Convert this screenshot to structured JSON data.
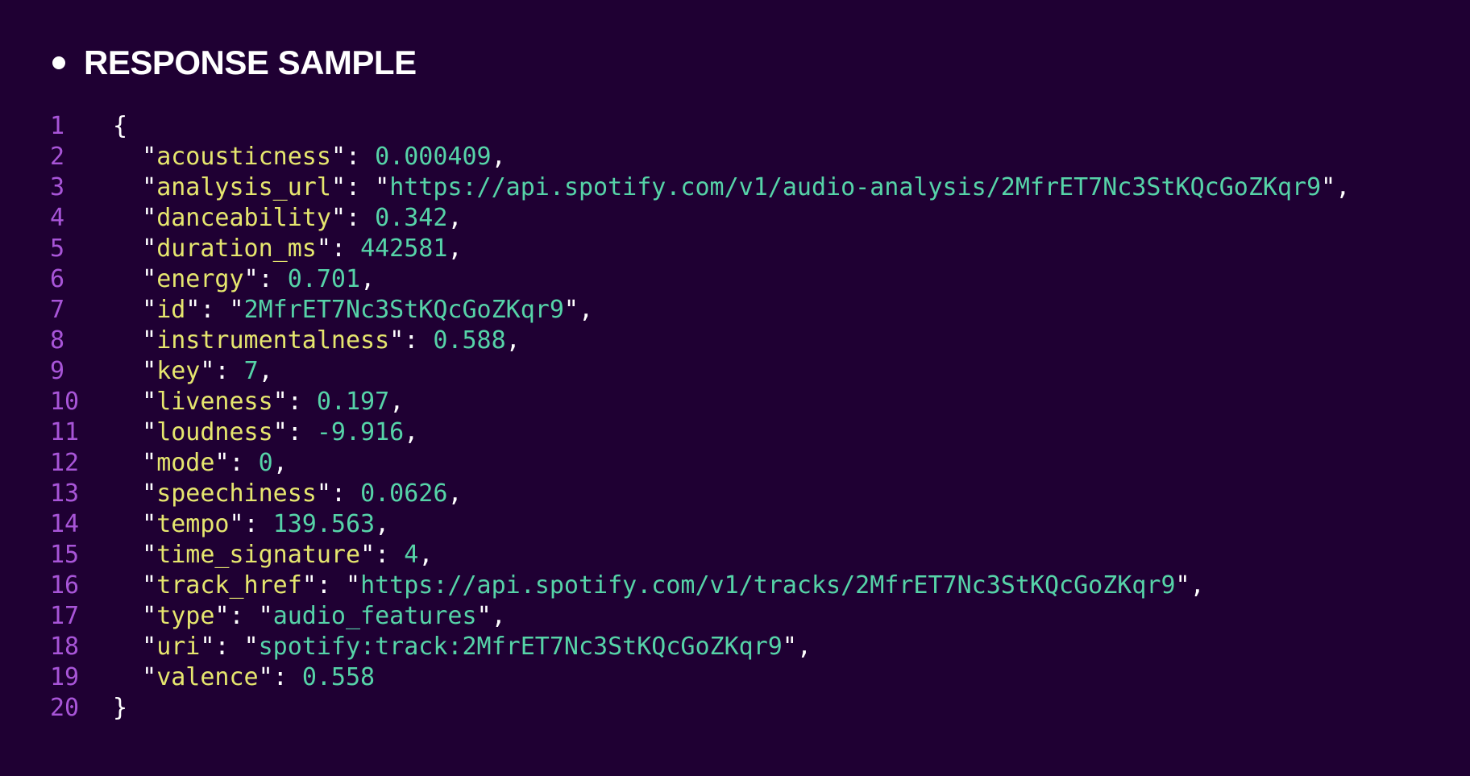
{
  "header": {
    "title": "RESPONSE SAMPLE"
  },
  "colors": {
    "background": "#1f0033",
    "line_number": "#a855d8",
    "key": "#e6e66e",
    "value": "#56d3a8",
    "punctuation": "#ffffff"
  },
  "code": {
    "lines": [
      {
        "num": "1",
        "open": "{"
      },
      {
        "num": "2",
        "key": "acousticness",
        "value": "0.000409",
        "type": "number",
        "comma": ","
      },
      {
        "num": "3",
        "key": "analysis_url",
        "value": "https://api.spotify.com/v1/audio-analysis/2MfrET7Nc3StKQcGoZKqr9",
        "type": "string",
        "comma": ","
      },
      {
        "num": "4",
        "key": "danceability",
        "value": "0.342",
        "type": "number",
        "comma": ","
      },
      {
        "num": "5",
        "key": "duration_ms",
        "value": "442581",
        "type": "number",
        "comma": ","
      },
      {
        "num": "6",
        "key": "energy",
        "value": "0.701",
        "type": "number",
        "comma": ","
      },
      {
        "num": "7",
        "key": "id",
        "value": "2MfrET7Nc3StKQcGoZKqr9",
        "type": "string",
        "comma": ","
      },
      {
        "num": "8",
        "key": "instrumentalness",
        "value": "0.588",
        "type": "number",
        "comma": ","
      },
      {
        "num": "9",
        "key": "key",
        "value": "7",
        "type": "number",
        "comma": ","
      },
      {
        "num": "10",
        "key": "liveness",
        "value": "0.197",
        "type": "number",
        "comma": ","
      },
      {
        "num": "11",
        "key": "loudness",
        "value": "-9.916",
        "type": "number",
        "comma": ","
      },
      {
        "num": "12",
        "key": "mode",
        "value": "0",
        "type": "number",
        "comma": ","
      },
      {
        "num": "13",
        "key": "speechiness",
        "value": "0.0626",
        "type": "number",
        "comma": ","
      },
      {
        "num": "14",
        "key": "tempo",
        "value": "139.563",
        "type": "number",
        "comma": ","
      },
      {
        "num": "15",
        "key": "time_signature",
        "value": "4",
        "type": "number",
        "comma": ","
      },
      {
        "num": "16",
        "key": "track_href",
        "value": "https://api.spotify.com/v1/tracks/2MfrET7Nc3StKQcGoZKqr9",
        "type": "string",
        "comma": ","
      },
      {
        "num": "17",
        "key": "type",
        "value": "audio_features",
        "type": "string",
        "comma": ","
      },
      {
        "num": "18",
        "key": "uri",
        "value": "spotify:track:2MfrET7Nc3StKQcGoZKqr9",
        "type": "string",
        "comma": ","
      },
      {
        "num": "19",
        "key": "valence",
        "value": "0.558",
        "type": "number",
        "comma": ""
      },
      {
        "num": "20",
        "close": "}"
      }
    ]
  }
}
